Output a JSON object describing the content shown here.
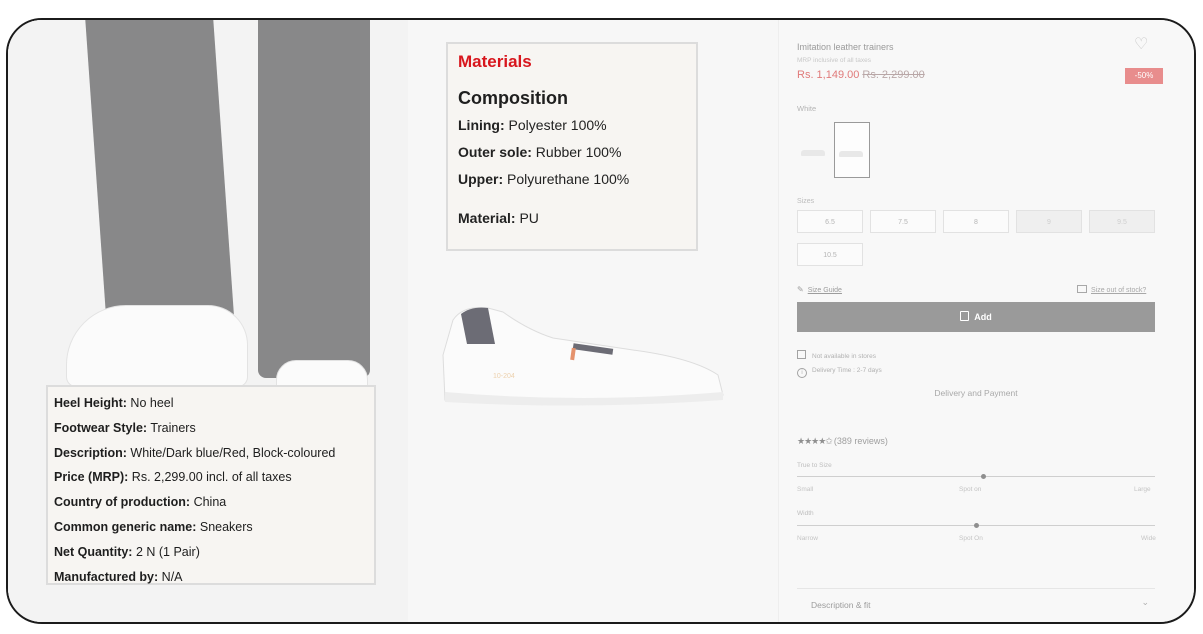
{
  "materials": {
    "title": "Materials",
    "composition_heading": "Composition",
    "lining_label": "Lining:",
    "lining_value": " Polyester 100%",
    "outer_sole_label": "Outer sole:",
    "outer_sole_value": " Rubber 100%",
    "upper_label": "Upper:",
    "upper_value": " Polyurethane 100%",
    "material_label": "Material:",
    "material_value": " PU"
  },
  "details": [
    {
      "label": "Heel Height:",
      "value": " No heel"
    },
    {
      "label": "Footwear Style:",
      "value": " Trainers"
    },
    {
      "label": "Description:",
      "value": " White/Dark blue/Red, Block-coloured"
    },
    {
      "label": "Price (MRP):",
      "value": " Rs. 2,299.00 incl. of all taxes"
    },
    {
      "label": "Country of production:",
      "value": " China"
    },
    {
      "label": "Common generic name:",
      "value": " Sneakers"
    },
    {
      "label": "Net Quantity:",
      "value": " 2 N (1 Pair)"
    },
    {
      "label": "Manufactured by:",
      "value": " N/A"
    }
  ],
  "product": {
    "title": "Imitation leather trainers",
    "mrp_note": "MRP inclusive of all taxes",
    "price": "Rs. 1,149.00",
    "old_price": "Rs. 2,299.00",
    "discount": "-50%",
    "color_label": "White",
    "heel_label_on_image": "10-204"
  },
  "sizes": {
    "label": "Sizes",
    "options": [
      {
        "value": "6.5",
        "available": true
      },
      {
        "value": "7.5",
        "available": true
      },
      {
        "value": "8",
        "available": true
      },
      {
        "value": "9",
        "available": false
      },
      {
        "value": "9.5",
        "available": false
      },
      {
        "value": "10.5",
        "available": true
      }
    ],
    "size_guide": "Size Guide",
    "out_of_stock_link": "Size out of stock?"
  },
  "actions": {
    "add_label": "Add"
  },
  "availability": {
    "stores": "Not available in stores",
    "delivery_time": "Delivery Time : 2-7 days",
    "delivery_payment": "Delivery and Payment"
  },
  "reviews": {
    "stars": "★★★★✩",
    "count_text": "(389 reviews)",
    "rating_fraction": 0.9
  },
  "fit": {
    "true_to_size_label": "True to Size",
    "true_to_size_scale": [
      "Small",
      "Spot on",
      "Large"
    ],
    "true_to_size_position": 0.52,
    "width_label": "Width",
    "width_scale": [
      "Narrow",
      "Spot On",
      "Wide"
    ],
    "width_position": 0.5
  },
  "accordion": {
    "description_fit": "Description & fit",
    "chevron": "⌄"
  },
  "icons": {
    "heart": "heart-icon",
    "pencil": "pencil-icon",
    "mail": "mail-icon",
    "bag": "bag-icon",
    "store": "store-icon",
    "info": "info-icon",
    "chevron": "chevron-down-icon"
  },
  "colors": {
    "materials_title": "#d8161d",
    "price_sale": "#e07a7a",
    "badge": "#e88d8d",
    "add_button": "#9a9a9a"
  }
}
